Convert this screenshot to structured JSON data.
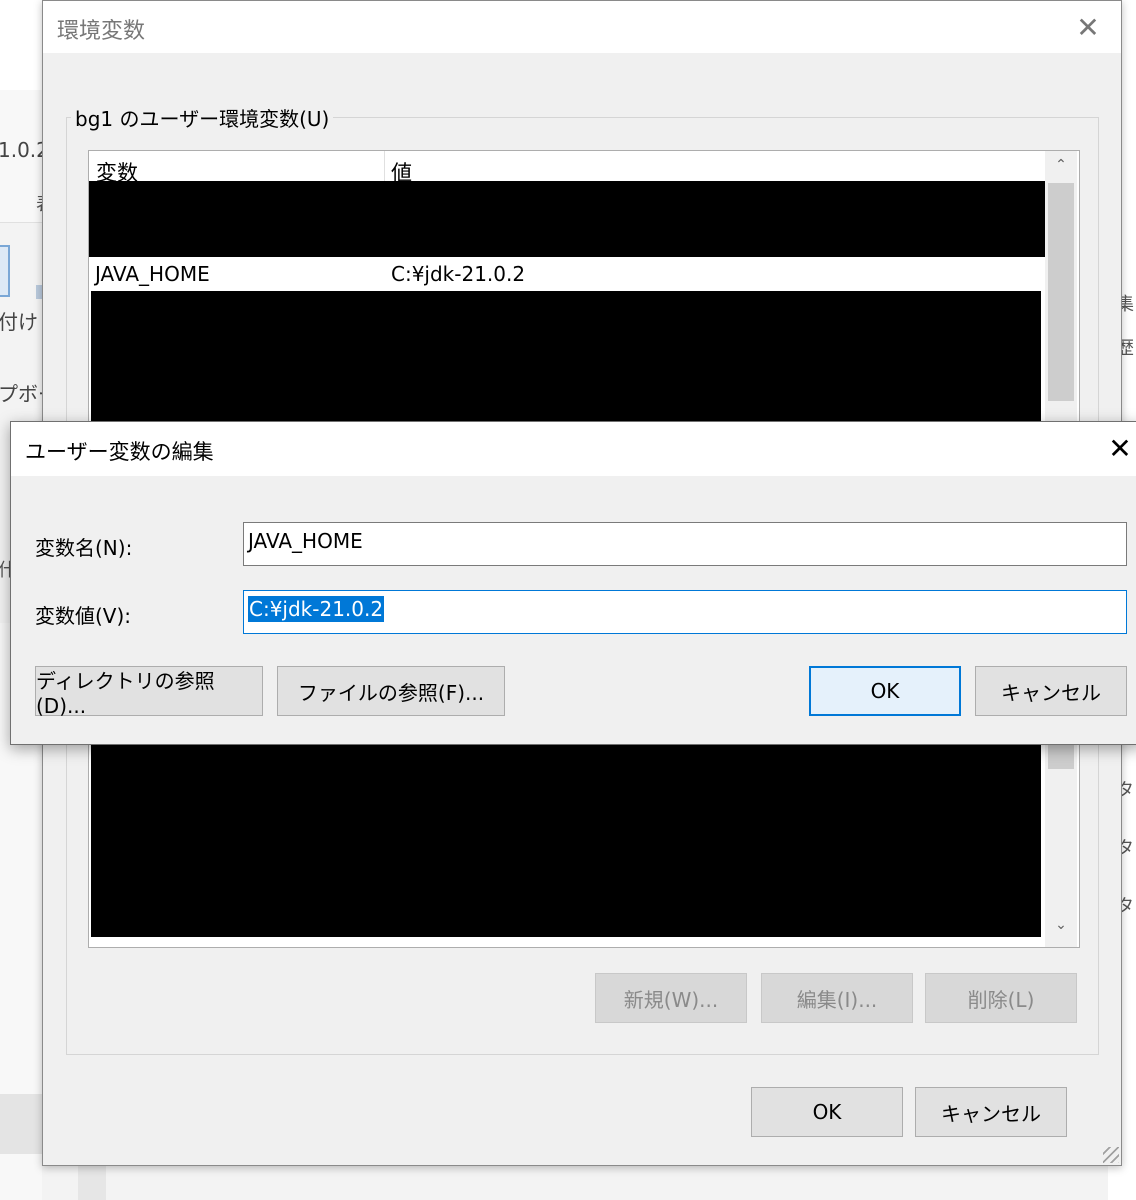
{
  "background": {
    "left_fragments": [
      "1.0.2",
      "表",
      "付け",
      "プボー",
      "什"
    ],
    "right_fragments": [
      "集",
      "歴",
      "タ",
      "タ",
      "タ"
    ]
  },
  "env_dialog": {
    "title": "環境変数",
    "group_label": "bg1 のユーザー環境変数(U)",
    "columns": [
      "変数",
      "値"
    ],
    "rows": [
      {
        "name": "JAVA_HOME",
        "value": "C:¥jdk-21.0.2"
      }
    ],
    "buttons": {
      "new": "新規(W)...",
      "edit": "編集(I)...",
      "delete": "削除(L)"
    },
    "ok": "OK",
    "cancel": "キャンセル"
  },
  "edit_dialog": {
    "title": "ユーザー変数の編集",
    "name_label": "変数名(N):",
    "value_label": "変数値(V):",
    "name_value": "JAVA_HOME",
    "value_value": "C:¥jdk-21.0.2",
    "browse_dir": "ディレクトリの参照(D)...",
    "browse_file": "ファイルの参照(F)...",
    "ok": "OK",
    "cancel": "キャンセル"
  },
  "icons": {
    "close": "close-icon",
    "scroll_up": "chevron-up-icon",
    "scroll_down": "chevron-down-icon"
  },
  "colors": {
    "accent": "#0078d7",
    "selection": "#0078d7",
    "dialog_bg": "#f0f0f0"
  }
}
